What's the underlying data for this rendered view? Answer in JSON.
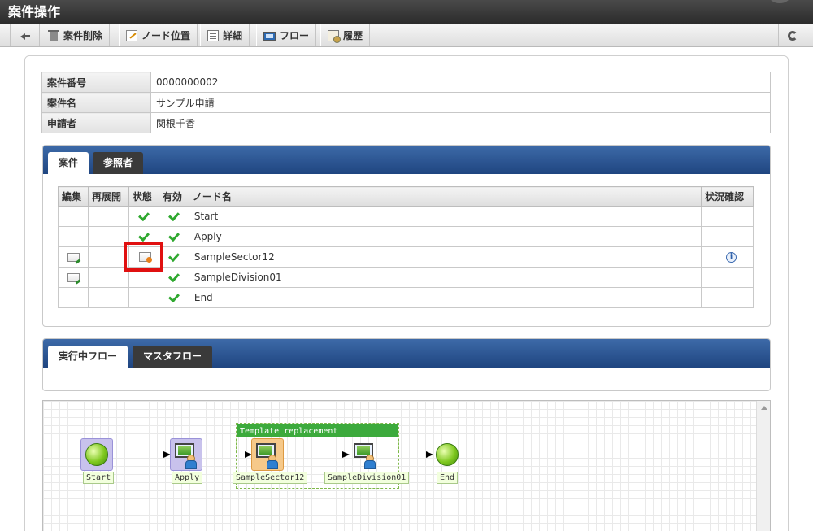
{
  "window": {
    "title": "案件操作"
  },
  "toolbar": {
    "buttons": [
      {
        "icon": "arrow-left-icon",
        "label": ""
      },
      {
        "icon": "trash-icon",
        "label": "案件削除"
      },
      {
        "icon": "edit-icon",
        "label": "ノード位置"
      },
      {
        "icon": "document-icon",
        "label": "詳細"
      },
      {
        "icon": "flow-icon",
        "label": "フロー"
      },
      {
        "icon": "history-icon",
        "label": "履歴"
      }
    ],
    "refresh_icon": "refresh-icon"
  },
  "info": {
    "rows": [
      {
        "key": "案件番号",
        "value": "0000000002"
      },
      {
        "key": "案件名",
        "value": "サンプル申請"
      },
      {
        "key": "申請者",
        "value": "関根千香"
      }
    ]
  },
  "node_panel": {
    "tabs": [
      "案件",
      "参照者"
    ],
    "active_tab": 0,
    "headers": [
      "編集",
      "再展開",
      "状態",
      "有効",
      "ノード名",
      "状況確認"
    ],
    "rows": [
      {
        "edit": false,
        "state": "done",
        "valid": true,
        "name": "Start",
        "info": false
      },
      {
        "edit": false,
        "state": "done",
        "valid": true,
        "name": "Apply",
        "info": false
      },
      {
        "edit": true,
        "state": "processing",
        "valid": true,
        "name": "SampleSector12",
        "info": true
      },
      {
        "edit": true,
        "state": "none",
        "valid": true,
        "name": "SampleDivision01",
        "info": false
      },
      {
        "edit": false,
        "state": "none",
        "valid": true,
        "name": "End",
        "info": false
      }
    ]
  },
  "flow_panel": {
    "tabs": [
      "実行中フロー",
      "マスタフロー"
    ],
    "active_tab": 0
  },
  "flow": {
    "group_title": "Template replacement",
    "nodes": [
      "Start",
      "Apply",
      "SampleSector12",
      "SampleDivision01",
      "End"
    ]
  },
  "colors": {
    "tab_bar": "#2a5291",
    "check": "#2fa82f",
    "highlight": "#e01010",
    "group": "#3caa3c"
  }
}
